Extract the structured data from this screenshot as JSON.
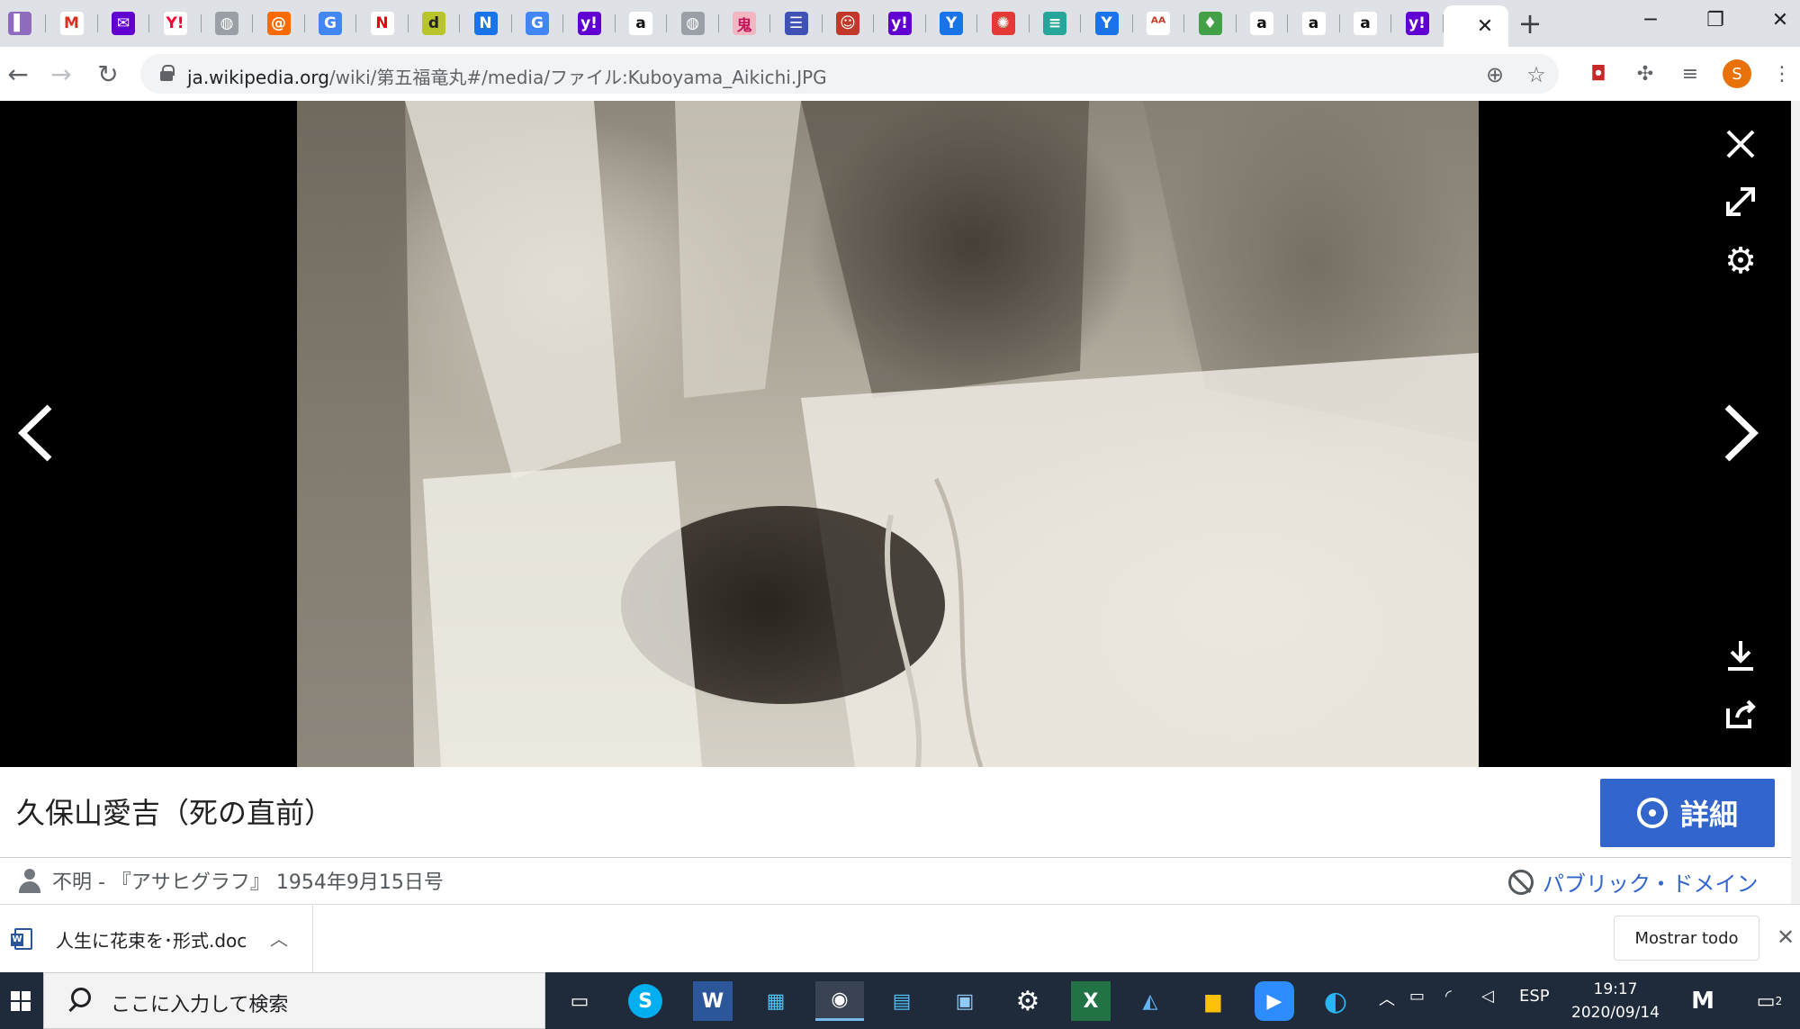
{
  "browser": {
    "tabs": [
      {
        "icon": "bookmark-icon",
        "color": "#8e6bbf",
        "glyph": "▌"
      },
      {
        "icon": "gmail-icon",
        "color": "#ffffff",
        "glyph": "M",
        "fg": "#d93025"
      },
      {
        "icon": "yahoo-mail-icon",
        "color": "#6001d2",
        "glyph": "✉"
      },
      {
        "icon": "yahoo-icon",
        "color": "#ffffff",
        "glyph": "Y!",
        "fg": "#ff0033"
      },
      {
        "icon": "globe-icon",
        "color": "#9aa0a6",
        "glyph": "◍"
      },
      {
        "icon": "at-icon",
        "color": "#ff6a00",
        "glyph": "@"
      },
      {
        "icon": "google-news-icon",
        "color": "#4285f4",
        "glyph": "G"
      },
      {
        "icon": "n-icon",
        "color": "#ffffff",
        "glyph": "N",
        "fg": "#e60012"
      },
      {
        "icon": "d-icon",
        "color": "#b8c52a",
        "glyph": "d",
        "fg": "#222222"
      },
      {
        "icon": "nhk-icon",
        "color": "#1a73e8",
        "glyph": "N"
      },
      {
        "icon": "translate-icon",
        "color": "#4285f4",
        "glyph": "G"
      },
      {
        "icon": "yahoo-y-icon",
        "color": "#6001d2",
        "glyph": "y!"
      },
      {
        "icon": "amazon-icon",
        "color": "#ffffff",
        "glyph": "a",
        "fg": "#111111"
      },
      {
        "icon": "globe-icon",
        "color": "#9aa0a6",
        "glyph": "◍"
      },
      {
        "icon": "oni-icon",
        "color": "#f4b6c2",
        "glyph": "鬼",
        "fg": "#c2185b"
      },
      {
        "icon": "rss-icon",
        "color": "#3f51b5",
        "glyph": "☰"
      },
      {
        "icon": "face-icon",
        "color": "#c0392b",
        "glyph": "☺"
      },
      {
        "icon": "yahoo-y-icon",
        "color": "#6001d2",
        "glyph": "y!"
      },
      {
        "icon": "y-icon",
        "color": "#1a73e8",
        "glyph": "Y"
      },
      {
        "icon": "spiral-icon",
        "color": "#e53935",
        "glyph": "✺"
      },
      {
        "icon": "lines-icon",
        "color": "#26a69a",
        "glyph": "≡"
      },
      {
        "icon": "y-icon",
        "color": "#1a73e8",
        "glyph": "Y"
      },
      {
        "icon": "aa-icon",
        "color": "#ffffff",
        "glyph": "ᴬᴬ",
        "fg": "#c0392b"
      },
      {
        "icon": "bulb-icon",
        "color": "#43a047",
        "glyph": "♦"
      },
      {
        "icon": "amazon-icon",
        "color": "#ffffff",
        "glyph": "a",
        "fg": "#111111"
      },
      {
        "icon": "amazon-icon",
        "color": "#ffffff",
        "glyph": "a",
        "fg": "#111111"
      },
      {
        "icon": "amazon-icon",
        "color": "#ffffff",
        "glyph": "a",
        "fg": "#111111"
      },
      {
        "icon": "yahoo-y-icon",
        "color": "#6001d2",
        "glyph": "y!"
      }
    ],
    "active_tab_close": "✕",
    "new_tab": "+",
    "url_host": "ja.wikipedia.org",
    "url_path": "/wiki/第五福竜丸#/media/ファイル:Kuboyama_Aikichi.JPG",
    "profile_initial": "S"
  },
  "viewer": {
    "title": "久保山愛吉（死の直前）",
    "details_label": "詳細",
    "author": "不明 - 『アサヒグラフ』 1954年9月15日号",
    "license": "パブリック・ドメイン"
  },
  "downloads": {
    "file_name": "人生に花束を･形式.doc",
    "show_all": "Mostrar todo"
  },
  "taskbar": {
    "search_placeholder": "ここに入力して検索",
    "language": "ESP",
    "time": "19:17",
    "date": "2020/09/14",
    "notification_count": "2"
  }
}
